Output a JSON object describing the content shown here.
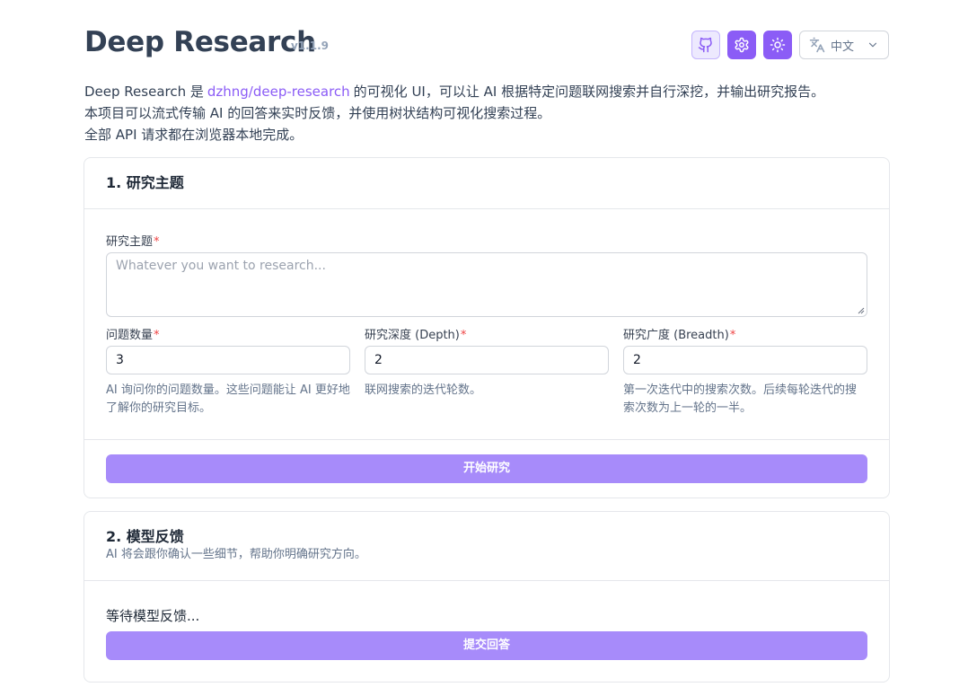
{
  "header": {
    "title": "Deep Research",
    "version": "v1.1.9",
    "icons": [
      "github-icon",
      "settings-icon",
      "sun-icon"
    ],
    "language": "中文"
  },
  "intro": {
    "line1_prefix": "Deep Research 是",
    "link_text": "dzhng/deep-research",
    "line1_suffix": "的可视化 UI，可以让 AI 根据特定问题联网搜索并自行深挖，并输出研究报告。",
    "line2": "本项目可以流式传输 AI 的回答来实时反馈，并使用树状结构可视化搜索过程。",
    "line3": "全部 API 请求都在浏览器本地完成。"
  },
  "section1": {
    "title": "1. 研究主题",
    "topic_label": "研究主题",
    "topic_placeholder": "Whatever you want to research...",
    "questions_label": "问题数量",
    "questions_value": "3",
    "questions_help": "AI 询问你的问题数量。这些问题能让 AI 更好地了解你的研究目标。",
    "depth_label": "研究深度 (Depth)",
    "depth_value": "2",
    "depth_help": "联网搜索的迭代轮数。",
    "breadth_label": "研究广度 (Breadth)",
    "breadth_value": "2",
    "breadth_help": "第一次迭代中的搜索次数。后续每轮迭代的搜索次数为上一轮的一半。",
    "required_mark": "*",
    "start_button": "开始研究"
  },
  "section2": {
    "title": "2. 模型反馈",
    "subtitle": "AI 将会跟你确认一些细节，帮助你明确研究方向。",
    "waiting_text": "等待模型反馈...",
    "submit_button": "提交回答"
  },
  "colors": {
    "accent": "#8b5cf6",
    "button": "#a78bfa",
    "link": "#8b5cf6",
    "required": "#ef4444"
  }
}
